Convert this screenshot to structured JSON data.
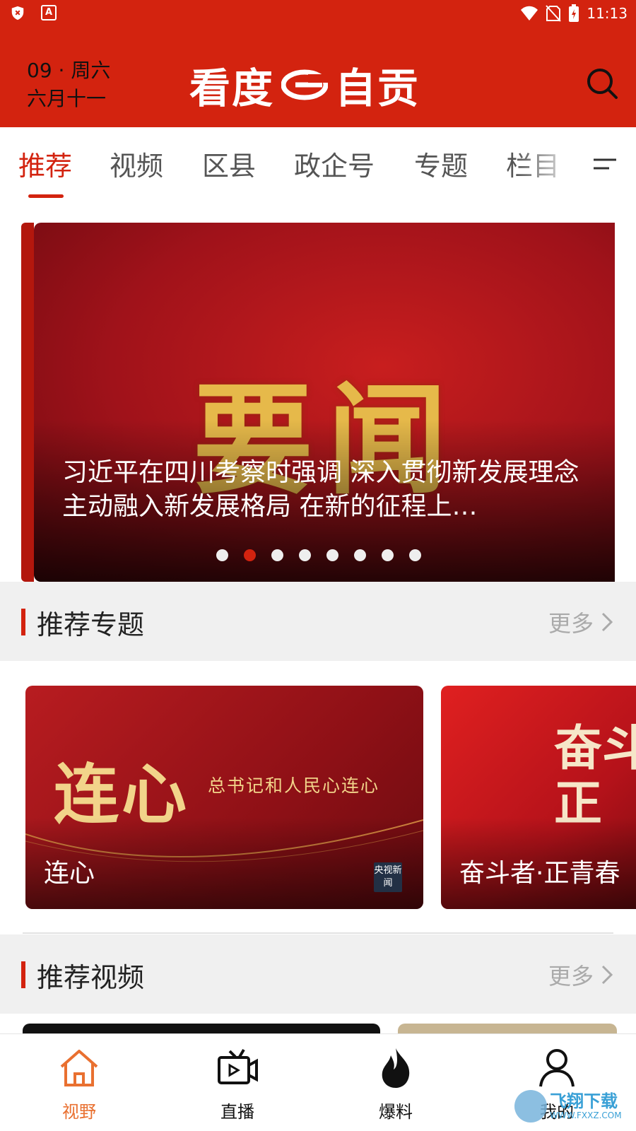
{
  "status_bar": {
    "time": "11:13",
    "left_icons": [
      "shield-x-icon",
      "a-badge-icon"
    ],
    "right_icons": [
      "wifi-icon",
      "no-sim-icon",
      "battery-charging-icon"
    ]
  },
  "header": {
    "date_line1": "09 · 周六",
    "date_line2": "六月十一",
    "logo_text_left": "看度",
    "logo_text_right": "自贡",
    "search_icon": "search-icon",
    "background_color": "#d3230f"
  },
  "tabs": {
    "items": [
      {
        "label": "推荐",
        "active": true
      },
      {
        "label": "视频",
        "active": false
      },
      {
        "label": "区县",
        "active": false
      },
      {
        "label": "政企号",
        "active": false
      },
      {
        "label": "专题",
        "active": false
      },
      {
        "label": "栏目",
        "active": false
      }
    ],
    "menu_icon": "menu-icon",
    "accent_color": "#d3230f"
  },
  "banner": {
    "image_text": "要闻",
    "title": "习近平在四川考察时强调  深入贯彻新发展理念主动融入新发展格局  在新的征程上…",
    "dots_total": 8,
    "dots_active_index": 1
  },
  "section_topics": {
    "title": "推荐专题",
    "more_label": "更多",
    "cards": [
      {
        "label": "连心",
        "art_text": "连心",
        "subtitle": "总书记和人民心连心",
        "badge": "央视新闻"
      },
      {
        "label": "奋斗者·正青春",
        "art_text": "奋斗 正"
      }
    ]
  },
  "section_videos": {
    "title": "推荐视频",
    "more_label": "更多"
  },
  "bottom_nav": {
    "items": [
      {
        "label": "视野",
        "icon": "home-icon",
        "active": true
      },
      {
        "label": "直播",
        "icon": "live-tv-icon",
        "active": false
      },
      {
        "label": "爆料",
        "icon": "flame-icon",
        "active": false
      },
      {
        "label": "我的",
        "icon": "user-icon",
        "active": false
      }
    ],
    "active_color": "#e97030"
  },
  "watermark": {
    "text": "飞翔下载",
    "url": "WWW.FXXZ.COM"
  }
}
